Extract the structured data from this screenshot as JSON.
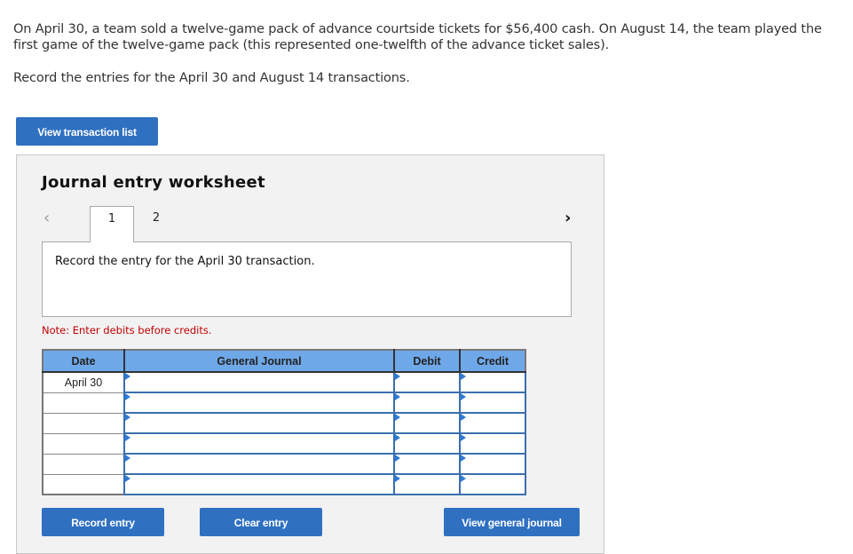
{
  "problem": {
    "paragraph": "On April 30, a team sold a twelve-game pack of advance courtside tickets for $56,400 cash. On August 14, the team played the first game of the twelve-game pack (this represented one-twelfth of the advance ticket sales).",
    "instruction": "Record the entries for the April 30 and August 14 transactions."
  },
  "buttons": {
    "view_transaction_list": "View transaction list",
    "record_entry": "Record entry",
    "clear_entry": "Clear entry",
    "view_general_journal": "View general journal"
  },
  "worksheet": {
    "title": "Journal entry worksheet",
    "nav_prev_icon": "‹",
    "nav_next_icon": "›",
    "tabs": [
      {
        "label": "1",
        "active": true
      },
      {
        "label": "2",
        "active": false
      }
    ],
    "prompt": "Record the entry for the April 30 transaction.",
    "note": "Note: Enter debits before credits."
  },
  "journal": {
    "headers": {
      "date": "Date",
      "general_journal": "General Journal",
      "debit": "Debit",
      "credit": "Credit"
    },
    "rows": [
      {
        "date": "April 30",
        "account": "",
        "debit": "",
        "credit": ""
      },
      {
        "date": "",
        "account": "",
        "debit": "",
        "credit": ""
      },
      {
        "date": "",
        "account": "",
        "debit": "",
        "credit": ""
      },
      {
        "date": "",
        "account": "",
        "debit": "",
        "credit": ""
      },
      {
        "date": "",
        "account": "",
        "debit": "",
        "credit": ""
      },
      {
        "date": "",
        "account": "",
        "debit": "",
        "credit": ""
      }
    ]
  }
}
